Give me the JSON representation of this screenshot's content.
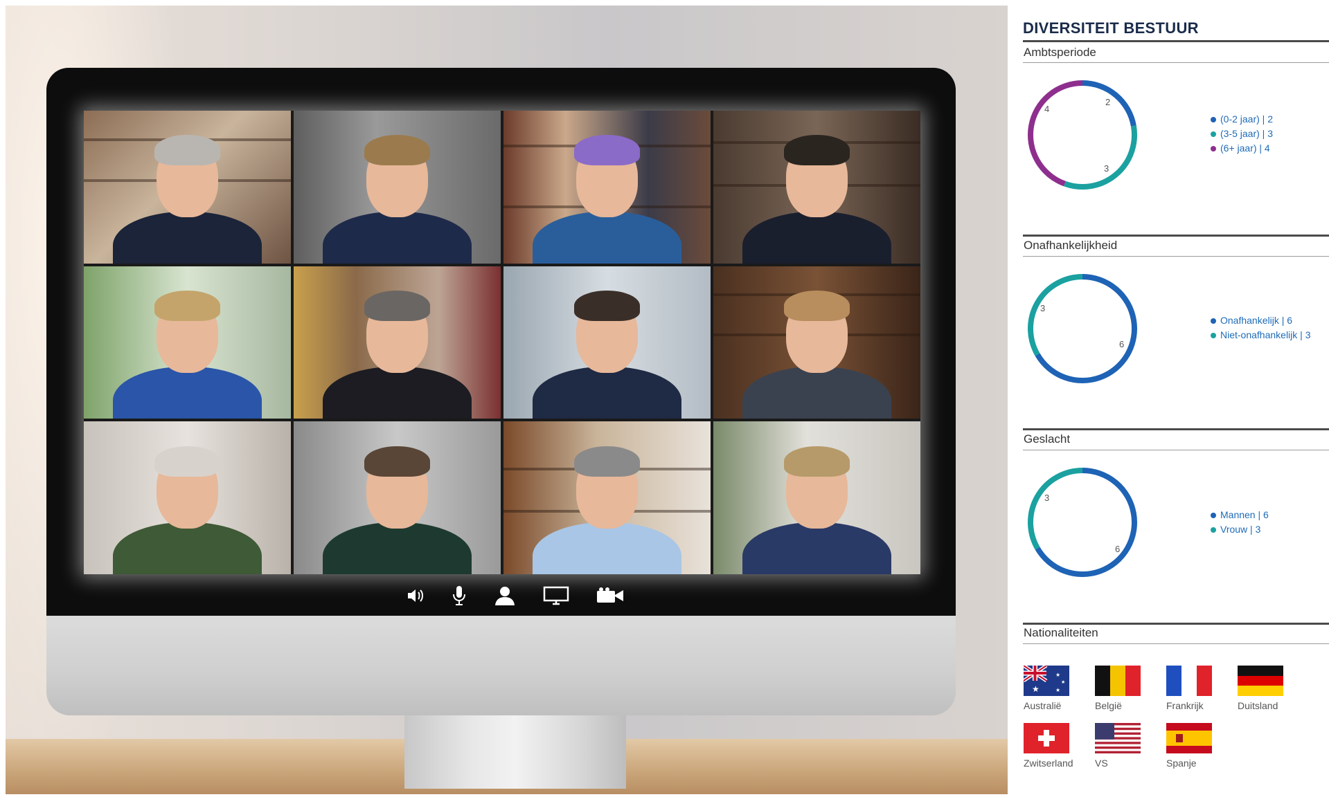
{
  "panel": {
    "title": "DIVERSITEIT BESTUUR",
    "sections": {
      "tenure": {
        "title": "Ambtsperiode",
        "legend": [
          {
            "label": "(0-2 jaar) | 2",
            "color": "#1e63b5"
          },
          {
            "label": "(3-5 jaar) | 3",
            "color": "#1aa1a0"
          },
          {
            "label": "(6+ jaar) | 4",
            "color": "#8e2f8e"
          }
        ],
        "values": [
          2,
          3,
          4
        ],
        "value_labels": [
          "2",
          "3",
          "4"
        ]
      },
      "independence": {
        "title": "Onafhankelijkheid",
        "legend": [
          {
            "label": "Onafhankelijk | 6",
            "color": "#1e63b5"
          },
          {
            "label": "Niet-onafhankelijk | 3",
            "color": "#1aa1a0"
          }
        ],
        "values": [
          6,
          3
        ],
        "value_labels": [
          "6",
          "3"
        ]
      },
      "gender": {
        "title": "Geslacht",
        "legend": [
          {
            "label": "Mannen | 6",
            "color": "#1e63b5"
          },
          {
            "label": "Vrouw | 3",
            "color": "#1aa1a0"
          }
        ],
        "values": [
          6,
          3
        ],
        "value_labels": [
          "6",
          "3"
        ]
      },
      "nationalities": {
        "title": "Nationaliteiten",
        "countries": [
          {
            "name": "Australië",
            "flag": "australia-flag"
          },
          {
            "name": "België",
            "flag": "belgium-flag"
          },
          {
            "name": "Frankrijk",
            "flag": "france-flag"
          },
          {
            "name": "Duitsland",
            "flag": "germany-flag"
          },
          {
            "name": "Zwitserland",
            "flag": "switzerland-flag"
          },
          {
            "name": "VS",
            "flag": "usa-flag"
          },
          {
            "name": "Spanje",
            "flag": "spain-flag"
          }
        ]
      }
    }
  },
  "video_call": {
    "participants": 12,
    "toolbar": [
      "speaker-icon",
      "microphone-icon",
      "participants-icon",
      "screen-share-icon",
      "camera-icon"
    ]
  }
}
